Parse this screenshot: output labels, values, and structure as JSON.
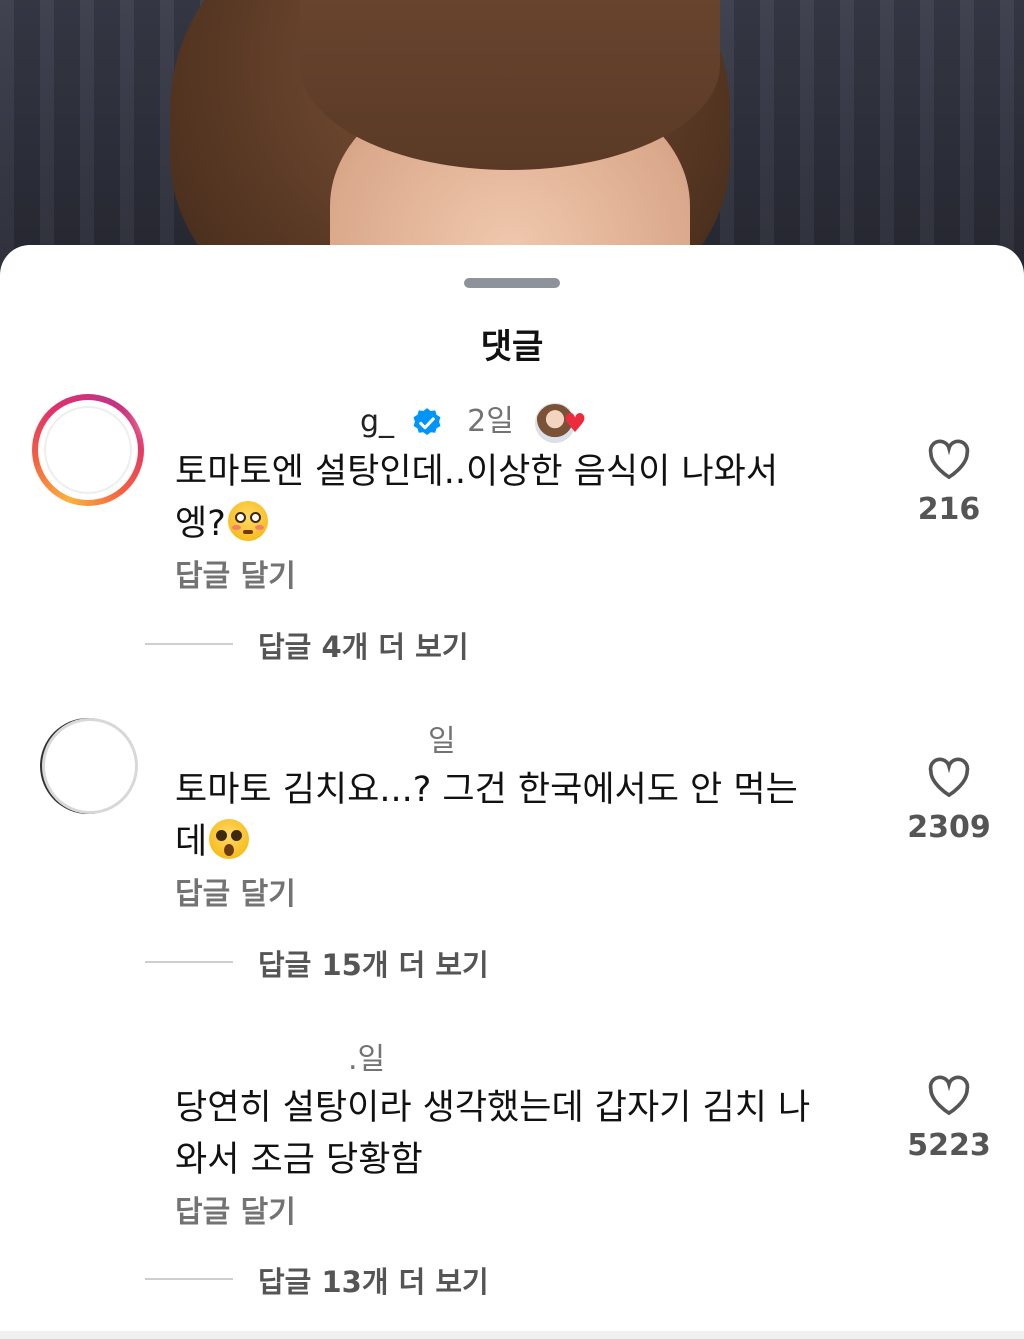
{
  "sheet": {
    "title": "댓글"
  },
  "comments": [
    {
      "username": "g_",
      "time": "2일",
      "verified": true,
      "author_liked": true,
      "text": "토마토엔 설탕인데..이상한 음식이 나와서 엥?",
      "emoji": "flushed-face",
      "reply_label": "답글 달기",
      "view_replies": "답글 4개 더 보기",
      "likes": "216"
    },
    {
      "username": "",
      "time": "일",
      "text": "토마토 김치요...? 그건 한국에서도 안 먹는데",
      "emoji": "astonished-face",
      "reply_label": "답글 달기",
      "view_replies": "답글 15개 더 보기",
      "likes": "2309"
    },
    {
      "username": "",
      "time": ".일",
      "text": "당연히 설탕이라 생각했는데 갑자기 김치 나와서 조금 당황함",
      "reply_label": "답글 달기",
      "view_replies": "답글 13개 더 보기",
      "likes": "5223"
    }
  ],
  "colors": {
    "like_count": "#555555",
    "verified": "#0095f6",
    "heart": "#ed2b3f"
  }
}
